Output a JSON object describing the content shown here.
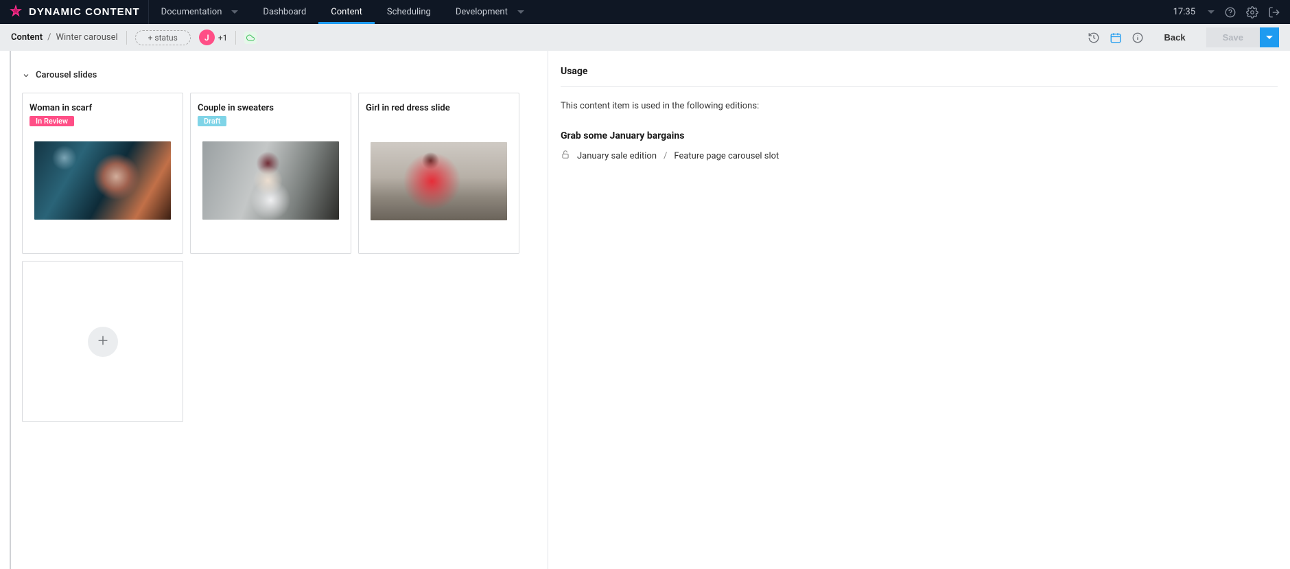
{
  "brand": "DYNAMIC CONTENT",
  "nav": {
    "documentation": "Documentation",
    "dashboard": "Dashboard",
    "content": "Content",
    "scheduling": "Scheduling",
    "development": "Development",
    "time": "17:35"
  },
  "subheader": {
    "crumb_root": "Content",
    "crumb_sep": "/",
    "crumb_current": "Winter carousel",
    "add_status": "+ status",
    "avatar_initial": "J",
    "avatar_extra": "+1",
    "back": "Back",
    "save": "Save"
  },
  "section": {
    "title": "Carousel slides"
  },
  "cards": [
    {
      "title": "Woman in scarf",
      "status": "In Review",
      "status_class": "review"
    },
    {
      "title": "Couple in sweaters",
      "status": "Draft",
      "status_class": "draft"
    },
    {
      "title": "Girl in red dress slide",
      "status": "",
      "status_class": ""
    }
  ],
  "right": {
    "title": "Usage",
    "desc": "This content item is used in the following editions:",
    "edition_title": "Grab some January bargains",
    "edition_name": "January sale edition",
    "slot_sep": "/",
    "slot_name": "Feature page carousel slot"
  },
  "colors": {
    "accent": "#1e9bf0",
    "pink": "#ff4e86",
    "draft": "#7fd4e7"
  }
}
